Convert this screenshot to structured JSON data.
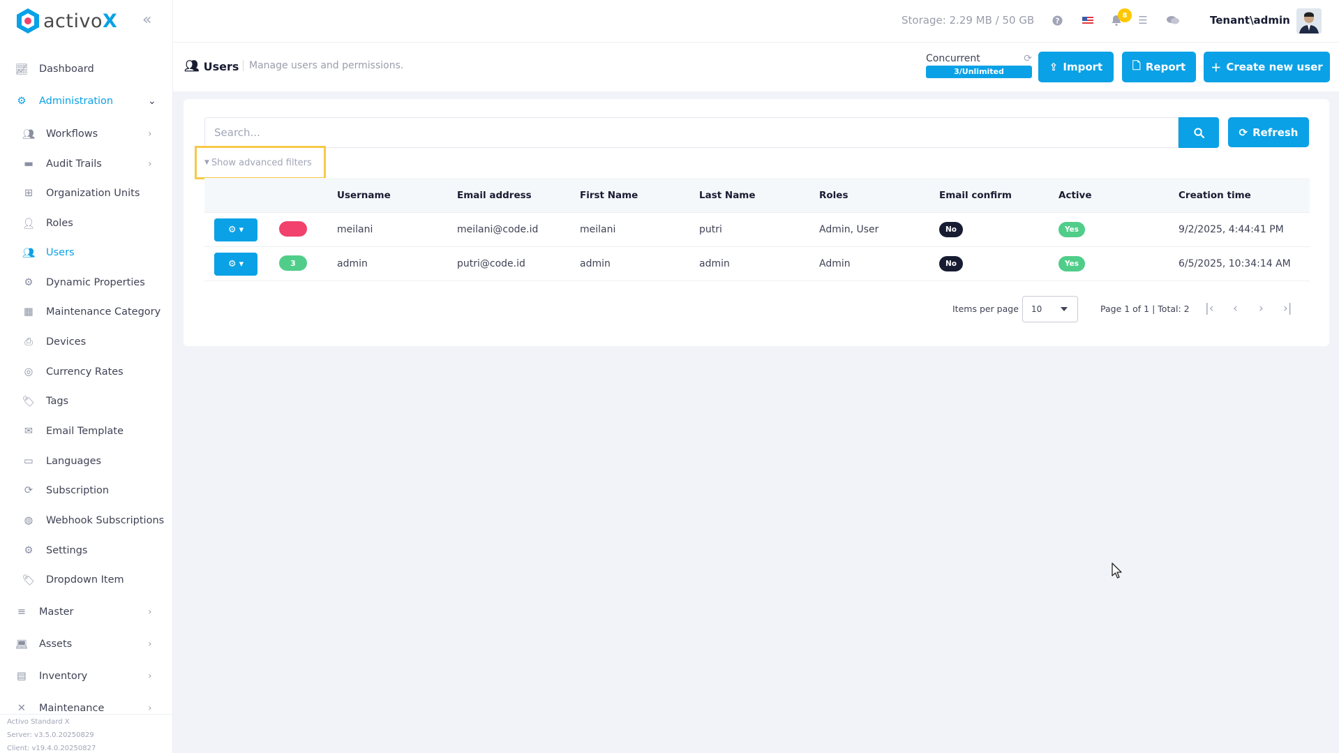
{
  "app": {
    "logo_prefix": "activo",
    "logo_suffix": "X"
  },
  "header": {
    "storage": "Storage: 2.29 MB / 50 GB",
    "notification_count": "8",
    "tenant_user": "Tenant\\admin"
  },
  "sidebar": {
    "items": [
      {
        "label": "Dashboard"
      },
      {
        "label": "Administration"
      },
      {
        "label": "Workflows"
      },
      {
        "label": "Audit Trails"
      },
      {
        "label": "Organization Units"
      },
      {
        "label": "Roles"
      },
      {
        "label": "Users"
      },
      {
        "label": "Dynamic Properties"
      },
      {
        "label": "Maintenance Category"
      },
      {
        "label": "Devices"
      },
      {
        "label": "Currency Rates"
      },
      {
        "label": "Tags"
      },
      {
        "label": "Email Template"
      },
      {
        "label": "Languages"
      },
      {
        "label": "Subscription"
      },
      {
        "label": "Webhook Subscriptions"
      },
      {
        "label": "Settings"
      },
      {
        "label": "Dropdown Item"
      },
      {
        "label": "Master"
      },
      {
        "label": "Assets"
      },
      {
        "label": "Inventory"
      },
      {
        "label": "Maintenance"
      }
    ],
    "footer": {
      "product": "Activo Standard X",
      "server": "Server: v3.5.0.20250829",
      "client": "Client: v19.4.0.20250827"
    }
  },
  "page": {
    "title": "Users",
    "description": "Manage users and permissions.",
    "concurrent_label": "Concurrent",
    "concurrent_value": "3/Unlimited",
    "import_label": "Import",
    "report_label": "Report",
    "create_label": "Create new user"
  },
  "filters": {
    "search_placeholder": "Search...",
    "refresh_label": "Refresh",
    "advanced_label": "Show advanced filters"
  },
  "table": {
    "headers": [
      "Username",
      "Email address",
      "First Name",
      "Last Name",
      "Roles",
      "Email confirm",
      "Active",
      "Creation time"
    ],
    "rows": [
      {
        "badge": "",
        "badge_color": "#f1416c",
        "username": "meilani",
        "email": "meilani@code.id",
        "first": "meilani",
        "last": "putri",
        "roles": "Admin, User",
        "email_confirm": "No",
        "active": "Yes",
        "created": "9/2/2025, 4:44:41 PM"
      },
      {
        "badge": "3",
        "badge_color": "#50cd89",
        "username": "admin",
        "email": "putri@code.id",
        "first": "admin",
        "last": "admin",
        "roles": "Admin",
        "email_confirm": "No",
        "active": "Yes",
        "created": "6/5/2025, 10:34:14 AM"
      }
    ]
  },
  "pagination": {
    "items_per_page_label": "Items per page",
    "items_per_page": "10",
    "summary": "Page 1 of 1 | Total: 2"
  },
  "colors": {
    "accent": "#0aa1e6",
    "highlight": "#f7c948",
    "no_badge": "#181c32",
    "yes_badge": "#50cd89"
  }
}
